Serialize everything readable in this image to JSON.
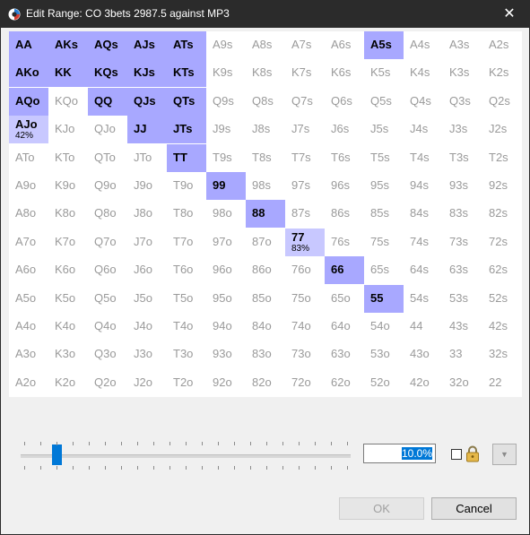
{
  "window": {
    "title": "Edit Range: CO 3bets 2987.5 against MP3",
    "close_glyph": "✕"
  },
  "colors": {
    "selected": "#a8a8ff",
    "partial": "#c8c8ff",
    "unselected_text": "#9a9a9a"
  },
  "grid": {
    "rows": [
      [
        "AA",
        "AKs",
        "AQs",
        "AJs",
        "ATs",
        "A9s",
        "A8s",
        "A7s",
        "A6s",
        "A5s",
        "A4s",
        "A3s",
        "A2s"
      ],
      [
        "AKo",
        "KK",
        "KQs",
        "KJs",
        "KTs",
        "K9s",
        "K8s",
        "K7s",
        "K6s",
        "K5s",
        "K4s",
        "K3s",
        "K2s"
      ],
      [
        "AQo",
        "KQo",
        "QQ",
        "QJs",
        "QTs",
        "Q9s",
        "Q8s",
        "Q7s",
        "Q6s",
        "Q5s",
        "Q4s",
        "Q3s",
        "Q2s"
      ],
      [
        "AJo",
        "KJo",
        "QJo",
        "JJ",
        "JTs",
        "J9s",
        "J8s",
        "J7s",
        "J6s",
        "J5s",
        "J4s",
        "J3s",
        "J2s"
      ],
      [
        "ATo",
        "KTo",
        "QTo",
        "JTo",
        "TT",
        "T9s",
        "T8s",
        "T7s",
        "T6s",
        "T5s",
        "T4s",
        "T3s",
        "T2s"
      ],
      [
        "A9o",
        "K9o",
        "Q9o",
        "J9o",
        "T9o",
        "99",
        "98s",
        "97s",
        "96s",
        "95s",
        "94s",
        "93s",
        "92s"
      ],
      [
        "A8o",
        "K8o",
        "Q8o",
        "J8o",
        "T8o",
        "98o",
        "88",
        "87s",
        "86s",
        "85s",
        "84s",
        "83s",
        "82s"
      ],
      [
        "A7o",
        "K7o",
        "Q7o",
        "J7o",
        "T7o",
        "97o",
        "87o",
        "77",
        "76s",
        "75s",
        "74s",
        "73s",
        "72s"
      ],
      [
        "A6o",
        "K6o",
        "Q6o",
        "J6o",
        "T6o",
        "96o",
        "86o",
        "76o",
        "66",
        "65s",
        "64s",
        "63s",
        "62s"
      ],
      [
        "A5o",
        "K5o",
        "Q5o",
        "J5o",
        "T5o",
        "95o",
        "85o",
        "75o",
        "65o",
        "55",
        "54s",
        "53s",
        "52s"
      ],
      [
        "A4o",
        "K4o",
        "Q4o",
        "J4o",
        "T4o",
        "94o",
        "84o",
        "74o",
        "64o",
        "54o",
        "44",
        "43s",
        "42s"
      ],
      [
        "A3o",
        "K3o",
        "Q3o",
        "J3o",
        "T3o",
        "93o",
        "83o",
        "73o",
        "63o",
        "53o",
        "43o",
        "33",
        "32s"
      ],
      [
        "A2o",
        "K2o",
        "Q2o",
        "J2o",
        "T2o",
        "92o",
        "82o",
        "72o",
        "62o",
        "52o",
        "42o",
        "32o",
        "22"
      ]
    ],
    "selected": [
      "AA",
      "AKs",
      "AQs",
      "AJs",
      "ATs",
      "A5s",
      "AKo",
      "KK",
      "KQs",
      "KJs",
      "KTs",
      "AQo",
      "QQ",
      "QJs",
      "QTs",
      "JJ",
      "JTs",
      "TT",
      "99",
      "88",
      "66",
      "55"
    ],
    "partial": {
      "AJo": "42%",
      "77": "83%"
    }
  },
  "controls": {
    "range_percent": "10.0%",
    "slider_value_percent": 10.0,
    "lock_checked": false,
    "ok_label": "OK",
    "cancel_label": "Cancel"
  }
}
